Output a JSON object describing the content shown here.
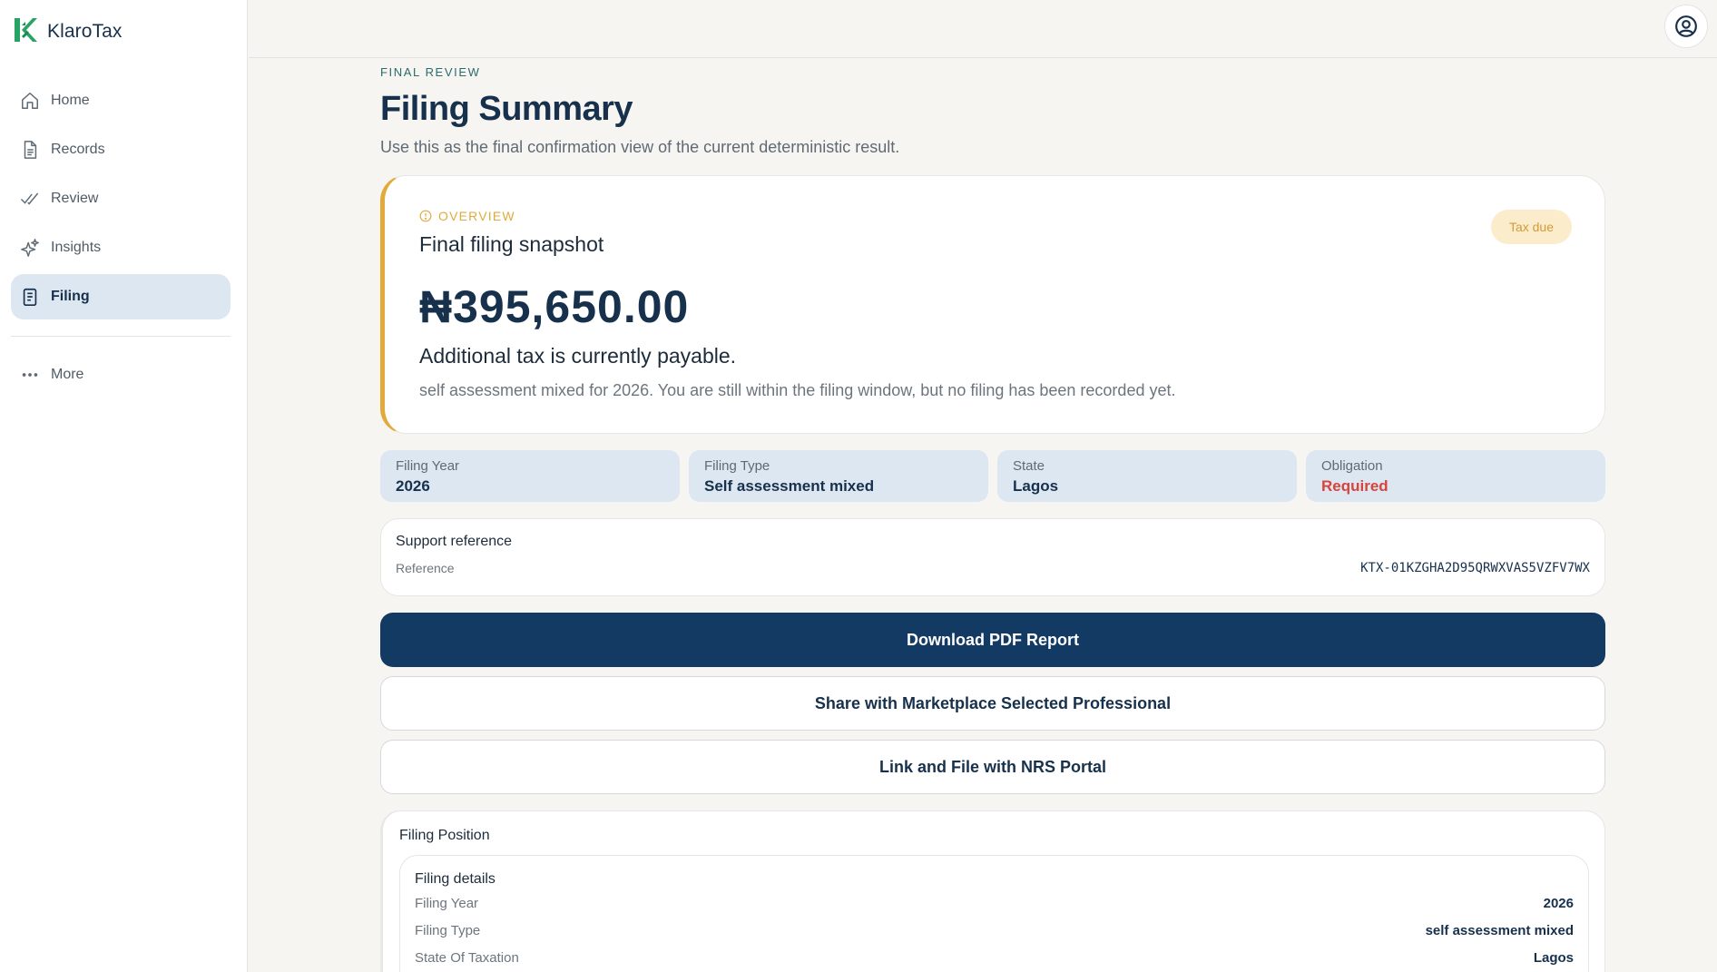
{
  "app": {
    "name": "KlaroTax",
    "accent": "#133a63",
    "brand_green": "#27a464"
  },
  "sidebar": {
    "items": [
      {
        "label": "Home",
        "icon": "home-icon",
        "active": false
      },
      {
        "label": "Records",
        "icon": "document-icon",
        "active": false
      },
      {
        "label": "Review",
        "icon": "double-check-icon",
        "active": false
      },
      {
        "label": "Insights",
        "icon": "sparkle-icon",
        "active": false
      },
      {
        "label": "Filing",
        "icon": "clipboard-icon",
        "active": true
      }
    ],
    "more": {
      "label": "More",
      "icon": "more-dots-icon"
    }
  },
  "topbar": {
    "account_icon": "user-circle-icon"
  },
  "page": {
    "eyebrow": "FINAL REVIEW",
    "title": "Filing Summary",
    "subtitle": "Use this as the final confirmation view of the current deterministic result."
  },
  "overview": {
    "label": "OVERVIEW",
    "title": "Final filing snapshot",
    "badge": "Tax due",
    "amount": "₦395,650.00",
    "headline": "Additional tax is currently payable.",
    "description": "self assessment mixed for 2026. You are still within the filing window, but no filing has been recorded yet.",
    "accent_color": "#e2a93b"
  },
  "facts": [
    {
      "label": "Filing Year",
      "value": "2026"
    },
    {
      "label": "Filing Type",
      "value": "Self assessment mixed"
    },
    {
      "label": "State",
      "value": "Lagos"
    },
    {
      "label": "Obligation",
      "value": "Required",
      "color": "#d8433a"
    }
  ],
  "support": {
    "title": "Support reference",
    "label": "Reference",
    "value": "KTX-01KZGHA2D95QRWXVAS5VZFV7WX"
  },
  "actions": {
    "download": "Download PDF Report",
    "share": "Share with Marketplace Selected Professional",
    "link": "Link and File with NRS Portal"
  },
  "position": {
    "title": "Filing Position",
    "details_title": "Filing details",
    "rows": [
      {
        "label": "Filing Year",
        "value": "2026"
      },
      {
        "label": "Filing Type",
        "value": "self assessment mixed"
      },
      {
        "label": "State Of Taxation",
        "value": "Lagos"
      }
    ]
  }
}
